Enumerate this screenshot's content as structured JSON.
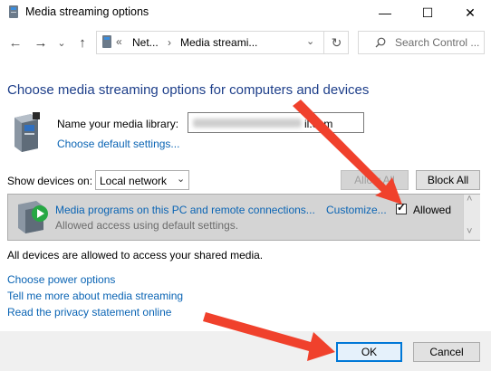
{
  "window": {
    "title": "Media streaming options",
    "minimize_glyph": "—",
    "maximize_glyph": "☐",
    "close_glyph": "✕"
  },
  "address": {
    "back_glyph": "←",
    "forward_glyph": "→",
    "recent_glyph": "⌄",
    "up_glyph": "↑",
    "overflow": "«",
    "crumb1": "Net...",
    "sep": "›",
    "crumb2": "Media streami...",
    "dropdown_glyph": "⌄",
    "refresh_glyph": "↻",
    "search_placeholder": "Search Control ..."
  },
  "main": {
    "heading": "Choose media streaming options for computers and devices",
    "library_label": "Name your media library:",
    "library_value_visible": "il.com",
    "default_settings_link": "Choose default settings...",
    "show_devices_label": "Show devices on:",
    "show_devices_value": "Local network",
    "combo_glyph": "⌄",
    "allow_all_button": "Allow All",
    "block_all_button": "Block All",
    "device": {
      "name": "Media programs on this PC and remote connections...",
      "customize": "Customize...",
      "allowed_label": "Allowed",
      "allowed_checked": true,
      "check_glyph": "✓",
      "status": "Allowed access using default settings."
    },
    "scroll_up_glyph": "˄",
    "scroll_down_glyph": "˅",
    "all_devices_note": "All devices are allowed to access your shared media.",
    "links": [
      "Choose power options",
      "Tell me more about media streaming",
      "Read the privacy statement online"
    ]
  },
  "footer": {
    "ok_button": "OK",
    "cancel_button": "Cancel"
  },
  "colors": {
    "heading": "#1e3f8a",
    "link": "#0a64b4",
    "annotation_arrow": "#f0412c",
    "ok_border": "#0078d7"
  },
  "icons": [
    "media-server-icon",
    "media-library-icon",
    "play-icon",
    "search-icon",
    "refresh-icon",
    "arrow-annotation"
  ]
}
